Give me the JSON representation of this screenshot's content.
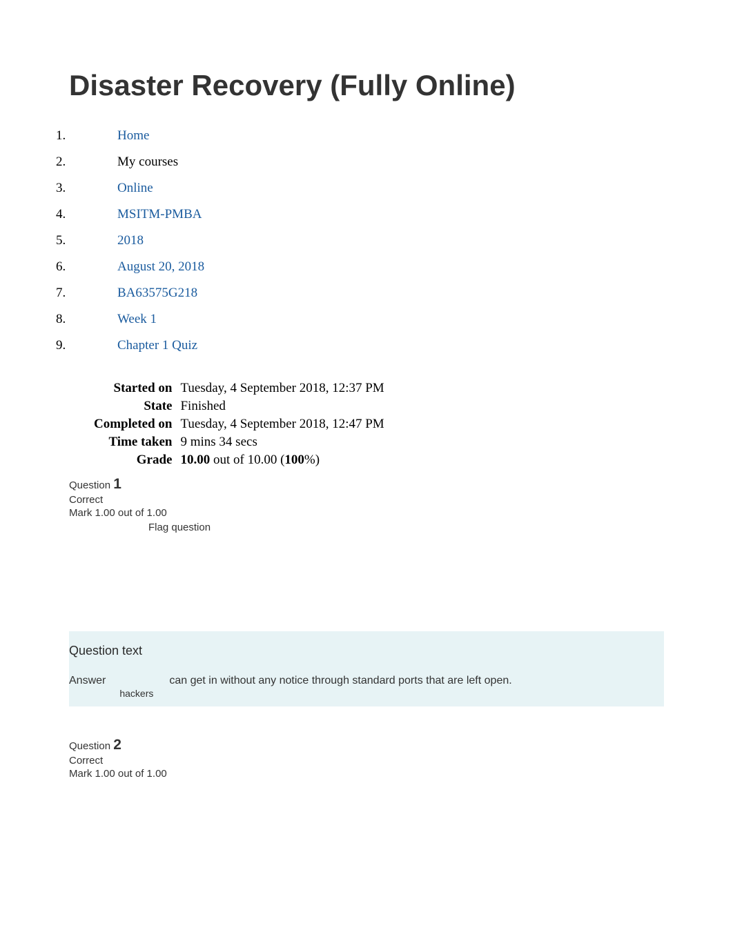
{
  "page_title": "Disaster Recovery (Fully Online)",
  "breadcrumb": [
    {
      "label": "Home",
      "link": true
    },
    {
      "label": "My courses",
      "link": false
    },
    {
      "label": "Online",
      "link": true
    },
    {
      "label": "MSITM-PMBA",
      "link": true
    },
    {
      "label": "2018",
      "link": true
    },
    {
      "label": "August 20, 2018",
      "link": true
    },
    {
      "label": "BA63575G218",
      "link": true
    },
    {
      "label": "Week 1",
      "link": true
    },
    {
      "label": "Chapter 1 Quiz",
      "link": true
    }
  ],
  "summary": {
    "started_on": {
      "label": "Started on",
      "value": "Tuesday, 4 September 2018, 12:37 PM"
    },
    "state": {
      "label": "State",
      "value": "Finished"
    },
    "completed_on": {
      "label": "Completed on",
      "value": "Tuesday, 4 September 2018, 12:47 PM"
    },
    "time_taken": {
      "label": "Time taken",
      "value": "9 mins 34 secs"
    },
    "grade": {
      "label": "Grade",
      "score": "10.00",
      "middle": " out of 10.00 (",
      "percent": "100",
      "suffix": "%)"
    }
  },
  "question1": {
    "prefix": "Question ",
    "number": "1",
    "status": "Correct",
    "mark": "Mark 1.00 out of 1.00",
    "flag": "Flag question",
    "qtext_title": "Question text",
    "answer_label": "Answer",
    "answer_value": "hackers",
    "answer_rest": "can get in without any notice through standard ports that are left open."
  },
  "question2": {
    "prefix": "Question ",
    "number": "2",
    "status": "Correct",
    "mark": "Mark 1.00 out of 1.00"
  }
}
